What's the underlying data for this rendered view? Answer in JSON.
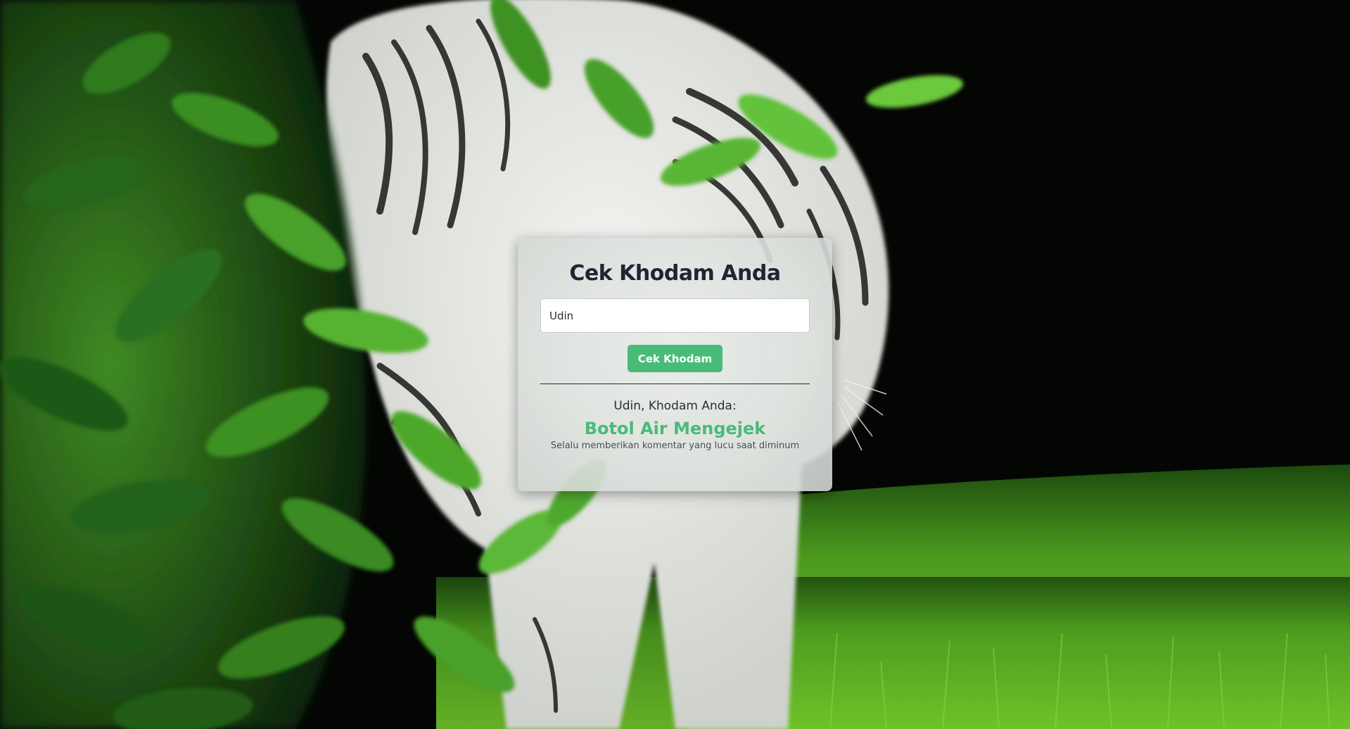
{
  "card": {
    "title": "Cek Khodam Anda",
    "input": {
      "value": "Udin",
      "placeholder": ""
    },
    "button_label": "Cek Khodam",
    "result": {
      "heading": "Udin, Khodam Anda:",
      "khodam_name": "Botol Air Mengejek",
      "description": "Selalu memberikan komentar yang lucu saat diminum"
    }
  },
  "colors": {
    "accent": "#48bb78",
    "title_text": "#1e2533",
    "card_background": "#e2e5e2"
  },
  "background": {
    "subject": "background-photo"
  }
}
